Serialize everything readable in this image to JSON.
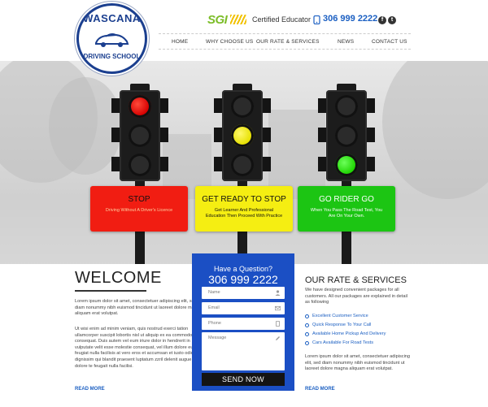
{
  "header": {
    "logo": {
      "top_text": "WASCANA",
      "bottom_text": "DRIVING SCHOOL"
    },
    "sgi_label": "SGI",
    "certified_label": "Certified Educator",
    "phone": "306 999 2222",
    "social": {
      "facebook": "f",
      "twitter": "t"
    },
    "nav": [
      "HOME",
      "WHY CHOOSE US",
      "OUR RATE & SERVICES",
      "NEWS",
      "CONTACT US"
    ]
  },
  "hero": {
    "panels": [
      {
        "title": "STOP",
        "text": "Driving Without A Driver's Licence",
        "color": "#f11d12"
      },
      {
        "title": "GET READY TO STOP",
        "text": "Get Learner And Professional Education Then Proceed With Practice",
        "color": "#f5ee12"
      },
      {
        "title": "GO RIDER GO",
        "text": "When You Pass The Road Test, You Are On Your Own.",
        "color": "#1cc513"
      }
    ],
    "lights": [
      "red",
      "yellow",
      "green"
    ]
  },
  "welcome": {
    "title": "WELCOME",
    "p1": "Lorem ipsum dolor sit amet, consectetuer adipiscing elit, sed diam nonummy nibh euismod tincidunt ut laoreet dolore magna aliquam erat volutpat.",
    "p2": "Ut wisi enim ad minim veniam, quis nostrud exerci tation ullamcorper suscipit lobortis nisl ut aliquip ex ea commodo consequat. Duis autem vel eum iriure dolor in hendrerit in vulputate velit esse molestie consequat, vel illum dolore eu feugiat nulla facilisis at vero eros et accumsan et iusto odio dignissim qui blandit praesent luptatum zzril delenit augue duis dolore te feugait nulla facilisi.",
    "read_more": "READ MORE"
  },
  "question": {
    "title": "Have a Question?",
    "phone": "306 999 2222",
    "fields": {
      "name": "Name",
      "email": "Email",
      "phone": "Phone",
      "message": "Message"
    },
    "send": "SEND NOW"
  },
  "rates": {
    "title": "OUR RATE & SERVICES",
    "intro": "We have designed convenient packages for all customers. All our packages are explained in detail as following",
    "items": [
      "Excellent Customer Service",
      "Quick Response To Your Call",
      "Available Home Pickup And Delivery",
      "Cars Available For Road Tests"
    ],
    "outro": "Lorem ipsum dolor sit amet, consectetuer adipiscing elit, sed diam nonummy nibh euismod tincidunt ut laoreet dolore magna aliquam erat volutpat.",
    "read_more": "READ MORE"
  },
  "colors": {
    "brand_blue": "#1b4fc4",
    "sgi_green": "#7cbd28",
    "link_blue": "#1b5fc2"
  }
}
